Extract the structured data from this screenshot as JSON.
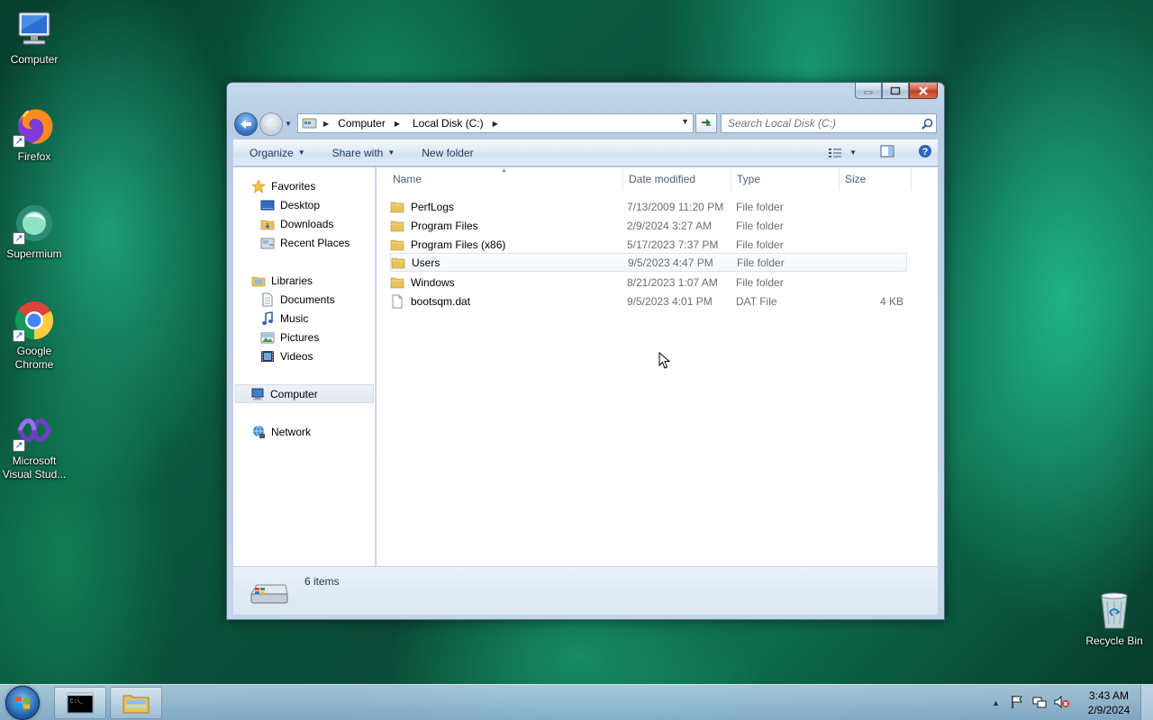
{
  "desktop": {
    "icons": [
      {
        "label": "Computer"
      },
      {
        "label": "Firefox"
      },
      {
        "label": "Supermium"
      },
      {
        "label": "Google Chrome"
      },
      {
        "label": "Microsoft Visual Stud..."
      },
      {
        "label": "Recycle Bin"
      }
    ]
  },
  "window": {
    "breadcrumb": [
      "Computer",
      "Local Disk (C:)"
    ],
    "search": {
      "placeholder": "Search Local Disk (C:)"
    },
    "toolbar": {
      "organize": "Organize",
      "share_with": "Share with",
      "new_folder": "New folder"
    },
    "nav": {
      "favorites": "Favorites",
      "desktop": "Desktop",
      "downloads": "Downloads",
      "recent_places": "Recent Places",
      "libraries": "Libraries",
      "documents": "Documents",
      "music": "Music",
      "pictures": "Pictures",
      "videos": "Videos",
      "computer": "Computer",
      "network": "Network"
    },
    "columns": {
      "name": "Name",
      "date": "Date modified",
      "type": "Type",
      "size": "Size"
    },
    "files": [
      {
        "name": "PerfLogs",
        "date": "7/13/2009 11:20 PM",
        "type": "File folder",
        "size": "",
        "kind": "folder"
      },
      {
        "name": "Program Files",
        "date": "2/9/2024 3:27 AM",
        "type": "File folder",
        "size": "",
        "kind": "folder"
      },
      {
        "name": "Program Files (x86)",
        "date": "5/17/2023 7:37 PM",
        "type": "File folder",
        "size": "",
        "kind": "folder"
      },
      {
        "name": "Users",
        "date": "9/5/2023 4:47 PM",
        "type": "File folder",
        "size": "",
        "kind": "folder"
      },
      {
        "name": "Windows",
        "date": "8/21/2023 1:07 AM",
        "type": "File folder",
        "size": "",
        "kind": "folder"
      },
      {
        "name": "bootsqm.dat",
        "date": "9/5/2023 4:01 PM",
        "type": "DAT File",
        "size": "4 KB",
        "kind": "file"
      }
    ],
    "status": {
      "item_count": "6 items"
    }
  },
  "taskbar": {
    "clock": {
      "time": "3:43 AM",
      "date": "2/9/2024"
    }
  },
  "colors": {
    "accent": "#1f5fa8",
    "folder": "#e8c25a",
    "hover_row": "#d8e3f0"
  }
}
